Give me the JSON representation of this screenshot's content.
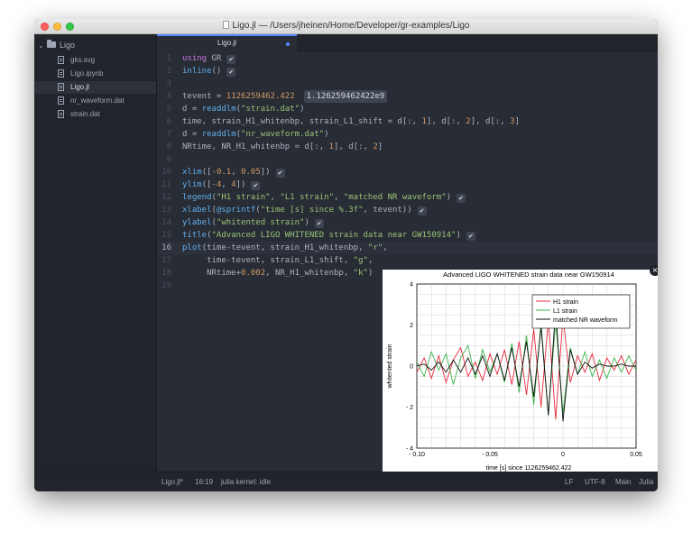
{
  "window": {
    "title": "Ligo.jl — /Users/jheinen/Home/Developer/gr-examples/Ligo"
  },
  "sidebar": {
    "root_label": "Ligo",
    "files": [
      {
        "name": "gks.svg",
        "selected": false
      },
      {
        "name": "Ligo.ipynb",
        "selected": false
      },
      {
        "name": "Ligo.jl",
        "selected": true
      },
      {
        "name": "nr_waveform.dat",
        "selected": false
      },
      {
        "name": "strain.dat",
        "selected": false
      }
    ]
  },
  "tab": {
    "label": "Ligo.jl"
  },
  "editor": {
    "line_numbers": [
      "1",
      "2",
      "3",
      "4",
      "5",
      "6",
      "7",
      "8",
      "9",
      "10",
      "11",
      "12",
      "13",
      "14",
      "15",
      "16",
      "17",
      "18",
      "19"
    ],
    "tevent_result": "1.126259462422e9",
    "check_glyph": "✔"
  },
  "plot": {
    "close_label": "×",
    "chart_data": {
      "type": "line",
      "title": "Advanced LIGO WHITENED strain data near GW150914",
      "xlabel": "time [s] since 1126259462.422",
      "ylabel": "whitented strain",
      "xlim": [
        -0.1,
        0.05
      ],
      "ylim": [
        -4,
        4
      ],
      "x_ticks": [
        "- 0.10",
        "- 0.05",
        "0",
        "0.05"
      ],
      "y_ticks": [
        "4",
        "2",
        "0",
        "- 2",
        "- 4"
      ],
      "grid": true,
      "legend_placement": "top-right",
      "series": [
        {
          "name": "H1 strain",
          "color": "#e8283c",
          "x": [
            -0.1,
            -0.095,
            -0.09,
            -0.085,
            -0.08,
            -0.075,
            -0.07,
            -0.065,
            -0.06,
            -0.055,
            -0.05,
            -0.045,
            -0.04,
            -0.035,
            -0.03,
            -0.025,
            -0.02,
            -0.015,
            -0.01,
            -0.005,
            0,
            0.005,
            0.01,
            0.015,
            0.02,
            0.025,
            0.03,
            0.035,
            0.04,
            0.045,
            0.05
          ],
          "y": [
            -0.3,
            0.4,
            -0.6,
            0.5,
            -0.8,
            0.3,
            0.9,
            -0.5,
            0.2,
            -0.7,
            0.6,
            -0.4,
            0.8,
            -0.9,
            1.2,
            -1.4,
            1.8,
            -2.0,
            2.3,
            -2.6,
            2.4,
            -0.8,
            0.5,
            -0.3,
            0.6,
            -0.7,
            0.4,
            -0.2,
            0.5,
            -0.4,
            0.3
          ]
        },
        {
          "name": "L1 strain",
          "color": "#3cb44b",
          "x": [
            -0.1,
            -0.095,
            -0.09,
            -0.085,
            -0.08,
            -0.075,
            -0.07,
            -0.065,
            -0.06,
            -0.055,
            -0.05,
            -0.045,
            -0.04,
            -0.035,
            -0.03,
            -0.025,
            -0.02,
            -0.015,
            -0.01,
            -0.005,
            0,
            0.005,
            0.01,
            0.015,
            0.02,
            0.025,
            0.03,
            0.035,
            0.04,
            0.045,
            0.05
          ],
          "y": [
            0.2,
            -0.5,
            0.7,
            -0.2,
            0.6,
            -0.9,
            0.4,
            1.0,
            -0.6,
            0.8,
            -0.3,
            0.6,
            -0.8,
            1.1,
            -1.3,
            1.5,
            -1.9,
            2.1,
            -2.4,
            2.2,
            -2.3,
            0.9,
            -0.4,
            0.7,
            -0.5,
            0.3,
            -0.6,
            0.4,
            -0.3,
            0.5,
            -0.2
          ]
        },
        {
          "name": "matched NR waveform",
          "color": "#111111",
          "x": [
            -0.1,
            -0.095,
            -0.09,
            -0.085,
            -0.08,
            -0.075,
            -0.07,
            -0.065,
            -0.06,
            -0.055,
            -0.05,
            -0.045,
            -0.04,
            -0.035,
            -0.03,
            -0.025,
            -0.02,
            -0.015,
            -0.01,
            -0.005,
            0,
            0.005,
            0.01,
            0.015,
            0.02,
            0.025,
            0.03,
            0.035,
            0.04,
            0.045,
            0.05
          ],
          "y": [
            0.0,
            0.1,
            -0.2,
            0.2,
            -0.3,
            0.3,
            -0.3,
            0.4,
            -0.4,
            0.5,
            -0.5,
            0.6,
            -0.7,
            0.9,
            -1.0,
            1.2,
            -1.5,
            1.9,
            -2.4,
            2.8,
            -2.7,
            0.8,
            -0.4,
            0.2,
            -0.1,
            0.1,
            0.0,
            0.0,
            0.1,
            0.0,
            0.0
          ]
        }
      ]
    }
  },
  "statusbar": {
    "file": "Ligo.jl*",
    "cursor": "16:19",
    "kernel": "julia kernel: idle",
    "line_ending": "LF",
    "encoding": "UTF-8",
    "module": "Main",
    "grammar": "Julia"
  }
}
